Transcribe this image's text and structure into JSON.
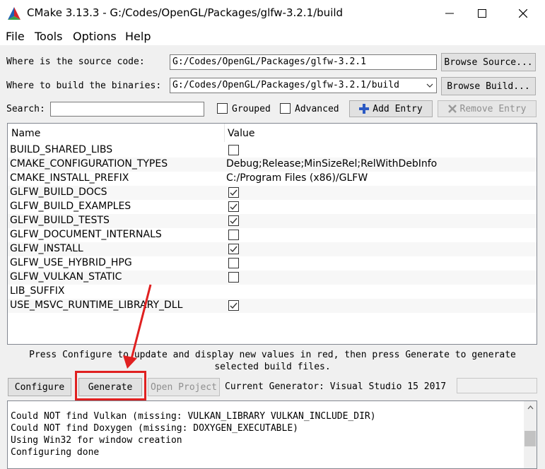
{
  "window": {
    "title": "CMake 3.13.3 - G:/Codes/OpenGL/Packages/glfw-3.2.1/build"
  },
  "menu": {
    "items": [
      "File",
      "Tools",
      "Options",
      "Help"
    ]
  },
  "source": {
    "label": "Where is the source code:",
    "value": "G:/Codes/OpenGL/Packages/glfw-3.2.1",
    "browse_label": "Browse Source..."
  },
  "build": {
    "label": "Where to build the binaries:",
    "value": "G:/Codes/OpenGL/Packages/glfw-3.2.1/build",
    "browse_label": "Browse Build..."
  },
  "search": {
    "label": "Search:",
    "value": "",
    "grouped_label": "Grouped",
    "grouped_checked": false,
    "advanced_label": "Advanced",
    "advanced_checked": false,
    "add_entry_label": "Add Entry",
    "remove_entry_label": "Remove Entry"
  },
  "table": {
    "headers": [
      "Name",
      "Value"
    ],
    "rows": [
      {
        "name": "BUILD_SHARED_LIBS",
        "type": "bool",
        "checked": false,
        "value": ""
      },
      {
        "name": "CMAKE_CONFIGURATION_TYPES",
        "type": "text",
        "checked": false,
        "value": "Debug;Release;MinSizeRel;RelWithDebInfo"
      },
      {
        "name": "CMAKE_INSTALL_PREFIX",
        "type": "text",
        "checked": false,
        "value": "C:/Program Files (x86)/GLFW"
      },
      {
        "name": "GLFW_BUILD_DOCS",
        "type": "bool",
        "checked": true,
        "value": ""
      },
      {
        "name": "GLFW_BUILD_EXAMPLES",
        "type": "bool",
        "checked": true,
        "value": ""
      },
      {
        "name": "GLFW_BUILD_TESTS",
        "type": "bool",
        "checked": true,
        "value": ""
      },
      {
        "name": "GLFW_DOCUMENT_INTERNALS",
        "type": "bool",
        "checked": false,
        "value": ""
      },
      {
        "name": "GLFW_INSTALL",
        "type": "bool",
        "checked": true,
        "value": ""
      },
      {
        "name": "GLFW_USE_HYBRID_HPG",
        "type": "bool",
        "checked": false,
        "value": ""
      },
      {
        "name": "GLFW_VULKAN_STATIC",
        "type": "bool",
        "checked": false,
        "value": ""
      },
      {
        "name": "LIB_SUFFIX",
        "type": "text",
        "checked": false,
        "value": ""
      },
      {
        "name": "USE_MSVC_RUNTIME_LIBRARY_DLL",
        "type": "bool",
        "checked": true,
        "value": ""
      }
    ]
  },
  "hint": {
    "line1": "Press Configure to update and display new values in red, then press Generate to generate",
    "line2": "selected build files."
  },
  "actions": {
    "configure_label": "Configure",
    "generate_label": "Generate",
    "open_project_label": "Open Project",
    "generator_text": "Current Generator: Visual Studio 15 2017"
  },
  "log": {
    "lines": [
      "Could NOT find Vulkan (missing: VULKAN_LIBRARY VULKAN_INCLUDE_DIR)",
      "Could NOT find Doxygen (missing: DOXYGEN_EXECUTABLE)",
      "Using Win32 for window creation",
      "Configuring done"
    ]
  },
  "colors": {
    "accent_red": "#e02020",
    "window_bg": "#f0f0f0"
  },
  "icons": {
    "app": "cmake-triangle-icon",
    "add": "plus-icon",
    "remove": "x-icon"
  }
}
